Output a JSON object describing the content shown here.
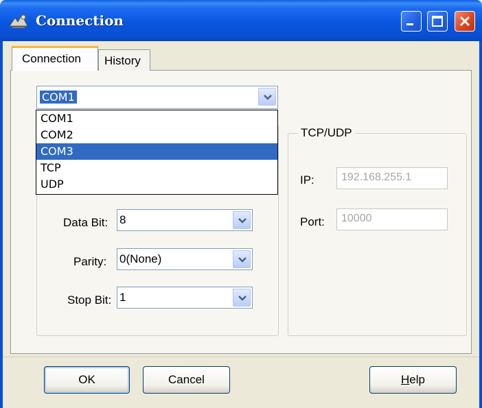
{
  "window": {
    "title": "Connection",
    "title_color": "#0a4fd4",
    "icons": [
      "app-icon",
      "minimize-icon",
      "maximize-icon",
      "close-icon"
    ]
  },
  "tabs": [
    {
      "label": "Connection",
      "active": true
    },
    {
      "label": "History",
      "active": false
    }
  ],
  "serial": {
    "port_selected": "COM1",
    "port_options": [
      "COM1",
      "COM2",
      "COM3",
      "TCP",
      "UDP"
    ],
    "port_highlighted": "COM3",
    "data_bit_label": "Data Bit:",
    "data_bit_value": "8",
    "parity_label": "Parity:",
    "parity_value": "0(None)",
    "stop_bit_label": "Stop Bit:",
    "stop_bit_value": "1"
  },
  "tcp_udp": {
    "title": "TCP/UDP",
    "ip_label": "IP:",
    "ip_value": "192.168.255.1",
    "port_label": "Port:",
    "port_value": "10000"
  },
  "buttons": {
    "ok": "OK",
    "cancel": "Cancel",
    "help_prefix": "H",
    "help_rest": "elp"
  },
  "colors": {
    "selection": "#316ac5",
    "accent_tab": "#f9b43c",
    "close_button": "#d9431d"
  }
}
